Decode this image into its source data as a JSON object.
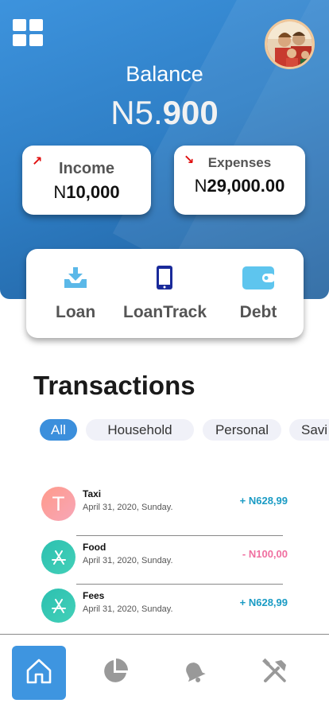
{
  "header": {
    "balance_label": "Balance",
    "balance_prefix": "N5.",
    "balance_bold": "900"
  },
  "income": {
    "label": "Income",
    "prefix": "N",
    "value": "10,000"
  },
  "expenses": {
    "label": "Expenses",
    "prefix": "N",
    "value": "29,000.00"
  },
  "actions": [
    {
      "label": "Loan",
      "icon": "download-tray-icon"
    },
    {
      "label": "LoanTrack",
      "icon": "phone-icon"
    },
    {
      "label": "Debt",
      "icon": "wallet-icon"
    }
  ],
  "transactions_title": "Transactions",
  "filters": [
    "All",
    "Household",
    "Personal",
    "Savi"
  ],
  "active_filter": "All",
  "transactions": [
    {
      "initial": "T",
      "name": "Taxi",
      "date": "April 31, 2020, Sunday.",
      "amount": "+ N628,99",
      "color": "#1a9bc4"
    },
    {
      "name": "Food",
      "date": "April 31, 2020, Sunday.",
      "amount": "- N100,00",
      "color": "#f06fa0"
    },
    {
      "name": "Fees",
      "date": "April 31, 2020, Sunday.",
      "amount": "+ N628,99",
      "color": "#1a9bc4"
    }
  ],
  "nav": [
    "home-icon",
    "pie-chart-icon",
    "bell-icon",
    "tools-icon"
  ],
  "colors": {
    "accent": "#3b8fdc",
    "income_arrow": "#e01010",
    "positive": "#1a9bc4",
    "negative": "#f06fa0"
  }
}
